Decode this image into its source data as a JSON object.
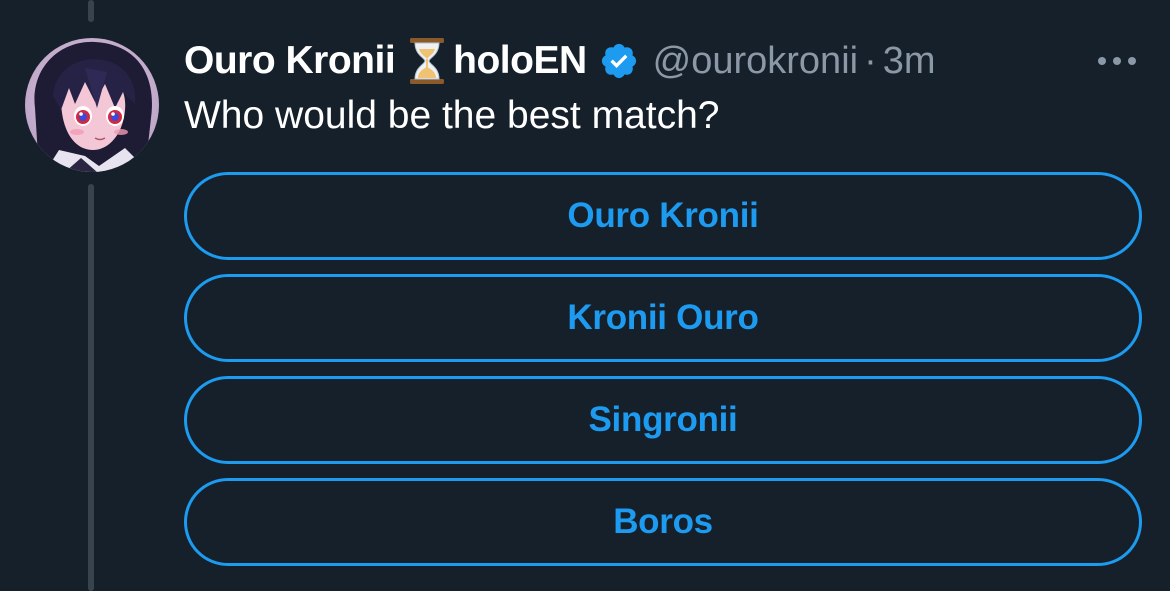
{
  "tweet": {
    "display_name": "Ouro Kronii",
    "display_name_suffix": "holoEN",
    "handle": "@ourokronii",
    "separator": "·",
    "time": "3m",
    "text": "Who would be the best match?"
  },
  "poll": {
    "options": [
      {
        "label": "Ouro Kronii"
      },
      {
        "label": "Kronii Ouro"
      },
      {
        "label": "Singronii"
      },
      {
        "label": "Boros"
      }
    ]
  },
  "icons": {
    "name_emoji": "hourglass-icon",
    "verified": "verified-badge-icon",
    "more": "more-options-icon"
  },
  "colors": {
    "background": "#15202b",
    "accent": "#1d9bf0",
    "secondary_text": "#8b98a5",
    "primary_text": "#ffffff",
    "thread_line": "#38444d"
  }
}
